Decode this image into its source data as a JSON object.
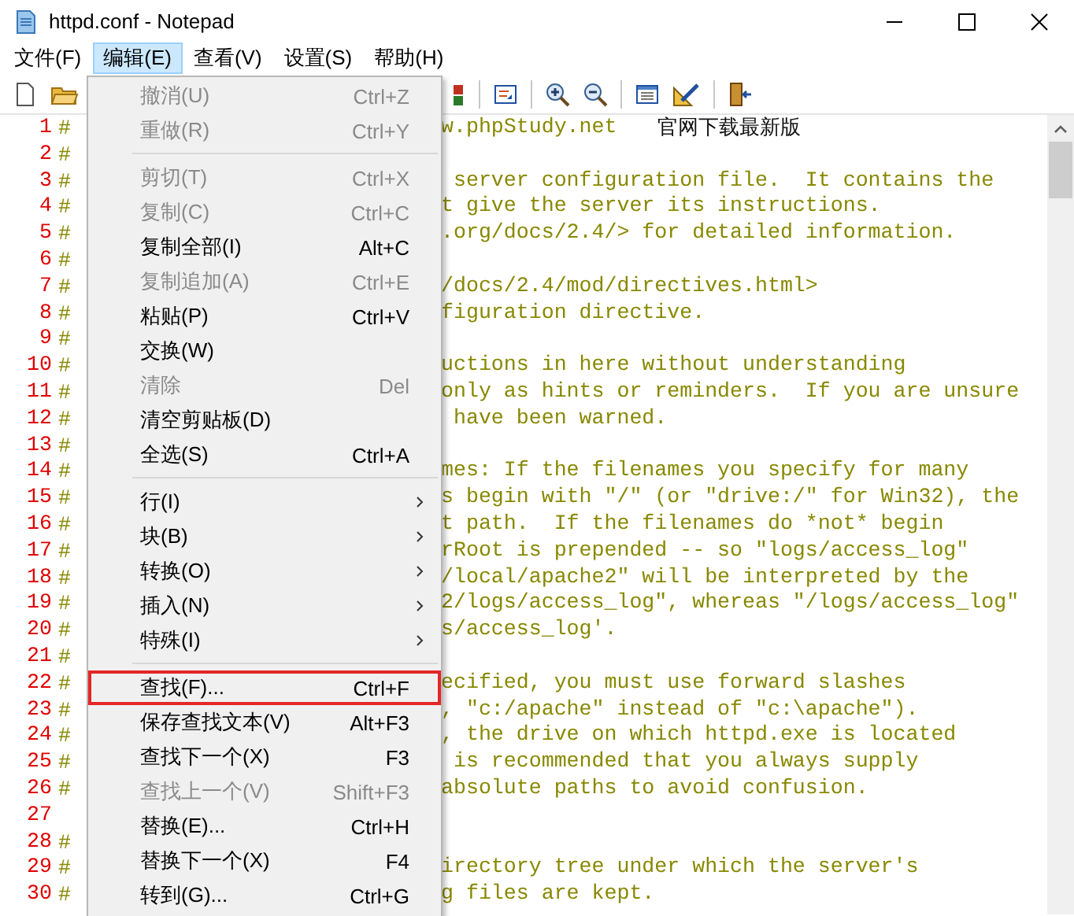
{
  "window": {
    "title": "httpd.conf - Notepad"
  },
  "menubar": [
    {
      "label": "文件(F)",
      "selected": false
    },
    {
      "label": "编辑(E)",
      "selected": true
    },
    {
      "label": "查看(V)",
      "selected": false
    },
    {
      "label": "设置(S)",
      "selected": false
    },
    {
      "label": "帮助(H)",
      "selected": false
    }
  ],
  "editor": {
    "lines": [
      {
        "number": "1",
        "mark": "#",
        "text": "w.phpStudy.net",
        "note": "官网下载最新版"
      },
      {
        "number": "2",
        "mark": "#"
      },
      {
        "number": "3",
        "mark": "#",
        "text": " server configuration file.  It contains the"
      },
      {
        "number": "4",
        "mark": "#",
        "text": "t give the server its instructions."
      },
      {
        "number": "5",
        "mark": "#",
        "text": ".org/docs/2.4/> for detailed information."
      },
      {
        "number": "6",
        "mark": "#"
      },
      {
        "number": "7",
        "mark": "#",
        "text": "/docs/2.4/mod/directives.html>"
      },
      {
        "number": "8",
        "mark": "#",
        "text": "figuration directive."
      },
      {
        "number": "9",
        "mark": "#"
      },
      {
        "number": "10",
        "mark": "#",
        "text": "uctions in here without understanding"
      },
      {
        "number": "11",
        "mark": "#",
        "text": "only as hints or reminders.  If you are unsure"
      },
      {
        "number": "12",
        "mark": "#",
        "text": " have been warned."
      },
      {
        "number": "13",
        "mark": "#"
      },
      {
        "number": "14",
        "mark": "#",
        "text": "mes: If the filenames you specify for many"
      },
      {
        "number": "15",
        "mark": "#",
        "text": "s begin with \"/\" (or \"drive:/\" for Win32), the"
      },
      {
        "number": "16",
        "mark": "#",
        "text": "t path.  If the filenames do *not* begin"
      },
      {
        "number": "17",
        "mark": "#",
        "text": "rRoot is prepended -- so \"logs/access_log\""
      },
      {
        "number": "18",
        "mark": "#",
        "text": "/local/apache2\" will be interpreted by the"
      },
      {
        "number": "19",
        "mark": "#",
        "text": "2/logs/access_log\", whereas \"/logs/access_log\""
      },
      {
        "number": "20",
        "mark": "#",
        "text": "s/access_log'."
      },
      {
        "number": "21",
        "mark": "#"
      },
      {
        "number": "22",
        "mark": "#",
        "text": "ecified, you must use forward slashes"
      },
      {
        "number": "23",
        "mark": "#",
        "text": ", \"c:/apache\" instead of \"c:\\apache\")."
      },
      {
        "number": "24",
        "mark": "#",
        "text": ", the drive on which httpd.exe is located"
      },
      {
        "number": "25",
        "mark": "#",
        "text": " is recommended that you always supply"
      },
      {
        "number": "26",
        "mark": "#",
        "text": "absolute paths to avoid confusion."
      },
      {
        "number": "27"
      },
      {
        "number": "28",
        "mark": "#"
      },
      {
        "number": "29",
        "mark": "#",
        "text": "irectory tree under which the server's"
      },
      {
        "number": "30",
        "mark": "#",
        "text": "g files are kept."
      }
    ]
  },
  "edit_menu": [
    {
      "kind": "item",
      "label": "撤消(U)",
      "shortcut": "Ctrl+Z",
      "disabled": true
    },
    {
      "kind": "item",
      "label": "重做(R)",
      "shortcut": "Ctrl+Y",
      "disabled": true
    },
    {
      "kind": "separator"
    },
    {
      "kind": "item",
      "label": "剪切(T)",
      "shortcut": "Ctrl+X",
      "disabled": true
    },
    {
      "kind": "item",
      "label": "复制(C)",
      "shortcut": "Ctrl+C",
      "disabled": true
    },
    {
      "kind": "item",
      "label": "复制全部(I)",
      "shortcut": "Alt+C",
      "disabled": false
    },
    {
      "kind": "item",
      "label": "复制追加(A)",
      "shortcut": "Ctrl+E",
      "disabled": true
    },
    {
      "kind": "item",
      "label": "粘贴(P)",
      "shortcut": "Ctrl+V",
      "disabled": false
    },
    {
      "kind": "item",
      "label": "交换(W)",
      "disabled": false
    },
    {
      "kind": "item",
      "label": "清除",
      "shortcut": "Del",
      "disabled": true
    },
    {
      "kind": "item",
      "label": "清空剪贴板(D)",
      "disabled": false
    },
    {
      "kind": "item",
      "label": "全选(S)",
      "shortcut": "Ctrl+A",
      "disabled": false
    },
    {
      "kind": "separator"
    },
    {
      "kind": "submenu",
      "label": "行(I)",
      "disabled": false
    },
    {
      "kind": "submenu",
      "label": "块(B)",
      "disabled": false
    },
    {
      "kind": "submenu",
      "label": "转换(O)",
      "disabled": false
    },
    {
      "kind": "submenu",
      "label": "插入(N)",
      "disabled": false
    },
    {
      "kind": "submenu",
      "label": "特殊(I)",
      "disabled": false
    },
    {
      "kind": "separator"
    },
    {
      "kind": "item",
      "label": "查找(F)...",
      "shortcut": "Ctrl+F",
      "disabled": false,
      "annotated": true
    },
    {
      "kind": "item",
      "label": "保存查找文本(V)",
      "shortcut": "Alt+F3",
      "disabled": false
    },
    {
      "kind": "item",
      "label": "查找下一个(X)",
      "shortcut": "F3",
      "disabled": false
    },
    {
      "kind": "item",
      "label": "查找上一个(V)",
      "shortcut": "Shift+F3",
      "disabled": true
    },
    {
      "kind": "item",
      "label": "替换(E)...",
      "shortcut": "Ctrl+H",
      "disabled": false
    },
    {
      "kind": "item",
      "label": "替换下一个(X)",
      "shortcut": "F4",
      "disabled": false
    },
    {
      "kind": "item",
      "label": "转到(G)...",
      "shortcut": "Ctrl+G",
      "disabled": false
    }
  ]
}
